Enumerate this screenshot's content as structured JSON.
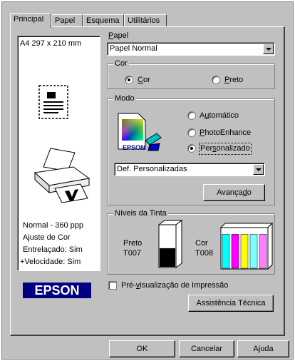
{
  "tabs": [
    "Principal",
    "Papel",
    "Esquema",
    "Utilitários"
  ],
  "preview": {
    "paper_size": "A4 297 x 210 mm",
    "status_lines": [
      "Normal - 360 ppp",
      "Ajuste de Cor",
      "Entrelaçado: Sim",
      "+Velocidade: Sim"
    ],
    "logo_text": "EPSON"
  },
  "papel": {
    "label": "Papel",
    "selected": "Papel Normal"
  },
  "cor": {
    "label": "Cor",
    "options": [
      "Cor",
      "Preto"
    ],
    "selected": "Cor"
  },
  "modo": {
    "label": "Modo",
    "options": [
      "Automático",
      "PhotoEnhance",
      "Personalizado"
    ],
    "selected": "Personalizado",
    "icon_brand": "EPSON",
    "custom_selected": "Def. Personalizadas",
    "advanced_label": "Avançado"
  },
  "ink": {
    "label": "Níveis da Tinta",
    "black_name": "Preto",
    "black_code": "T007",
    "black_level": 0.45,
    "color_name": "Cor",
    "color_code": "T008",
    "color_levels": [
      0.85,
      0.85,
      0.85,
      0.85,
      0.85
    ],
    "colors": [
      "#00ffff",
      "#ff00ff",
      "#ffff00",
      "#80ffff",
      "#ff80ff"
    ]
  },
  "preview_checkbox": "Pré-visualização de Impressão",
  "support_button": "Assistência Técnica",
  "buttons": {
    "ok": "OK",
    "cancel": "Cancelar",
    "help": "Ajuda"
  },
  "colors": {
    "dialog": "#c0c0c0",
    "logo_bg": "#000080"
  }
}
